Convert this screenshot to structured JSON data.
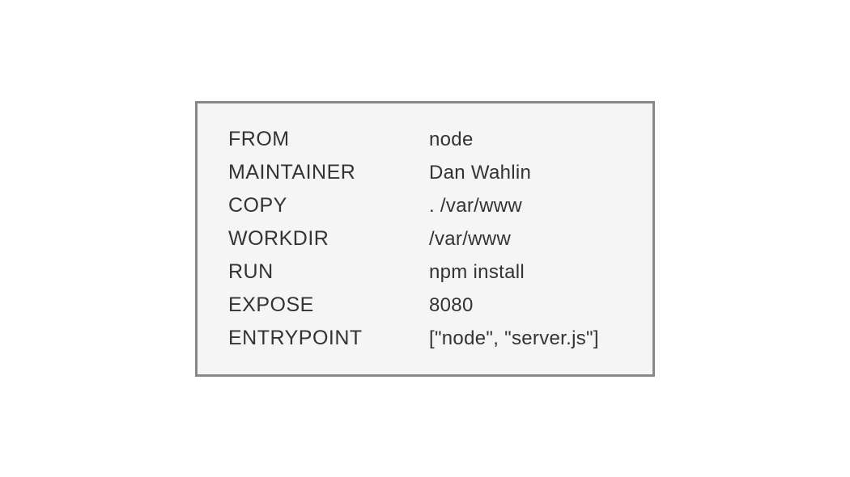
{
  "dockerfile": {
    "lines": [
      {
        "keyword": "FROM",
        "value": "node"
      },
      {
        "keyword": "MAINTAINER",
        "value": "Dan Wahlin"
      },
      {
        "keyword": "COPY",
        "value": ".  /var/www"
      },
      {
        "keyword": "WORKDIR",
        "value": "/var/www"
      },
      {
        "keyword": "RUN",
        "value": "npm install"
      },
      {
        "keyword": "EXPOSE",
        "value": "8080"
      },
      {
        "keyword": "ENTRYPOINT",
        "value": "[\"node\", \"server.js\"]"
      }
    ]
  }
}
